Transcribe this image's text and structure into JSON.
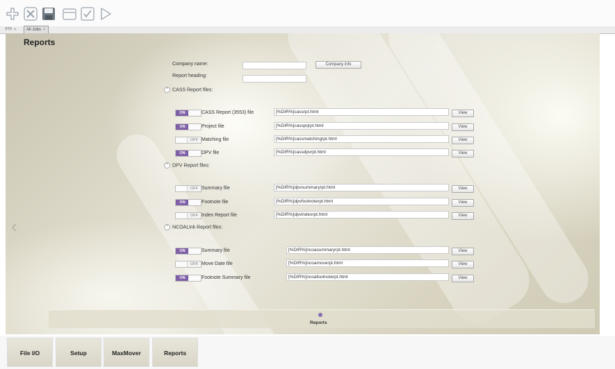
{
  "toolbar": {
    "icons": [
      "add-icon",
      "delete-icon",
      "save-icon",
      "folder-icon",
      "check-icon",
      "play-icon"
    ]
  },
  "tabs": [
    {
      "label": "???",
      "close": "✕"
    },
    {
      "label": "All Jobs",
      "close": "✕"
    }
  ],
  "page": {
    "title": "Reports"
  },
  "company": {
    "name_label": "Company name:",
    "name_value": "",
    "heading_label": "Report heading:",
    "heading_value": "",
    "info_button": "Company info"
  },
  "sections": {
    "cass": {
      "title": "CASS Report files:",
      "rows": [
        {
          "state": "ON",
          "label": "CASS Report (3553) file",
          "path": "[%DIR%]cassrpt.html",
          "button": "View"
        },
        {
          "state": "ON",
          "label": "Project file",
          "path": "[%DIR%]cassprjrpt.html",
          "button": "View"
        },
        {
          "state": "OFF",
          "label": "Matching file",
          "path": "[%DIR%]cassmatchingrpt.html",
          "button": "View"
        },
        {
          "state": "ON",
          "label": "DPV file",
          "path": "[%DIR%]cassdpvrpt.html",
          "button": "View"
        }
      ]
    },
    "dpv": {
      "title": "DPV Report files:",
      "rows": [
        {
          "state": "OFF",
          "label": "Summary file",
          "path": "[%DIR%]dpvsummaryrpt.html",
          "button": "View"
        },
        {
          "state": "ON",
          "label": "Footnote file",
          "path": "[%DIR%]dpvfootnoterpt.html",
          "button": "View"
        },
        {
          "state": "OFF",
          "label": "Index Report file",
          "path": "[%DIR%]dpvindexrpt.html",
          "button": "View"
        }
      ]
    },
    "ncoa": {
      "title": "NCOALink Report files:",
      "rows": [
        {
          "state": "ON",
          "label": "Summary file",
          "path": "[%DIR%]ncoasummaryrpt.html",
          "button": "View"
        },
        {
          "state": "OFF",
          "label": "Move Date file",
          "path": "[%DIR%]ncoamoverpt.html",
          "button": "View"
        },
        {
          "state": "ON",
          "label": "Footnote Summary file",
          "path": "[%DIR%]ncoafootnoterpt.html",
          "button": "View"
        }
      ]
    }
  },
  "pager": {
    "label": "Reports"
  },
  "nav": {
    "items": [
      "File I/O",
      "Setup",
      "MaxMover",
      "Reports"
    ]
  },
  "colors": {
    "toggle_on": "#7f5fa6",
    "accent": "#8a6fb0"
  }
}
